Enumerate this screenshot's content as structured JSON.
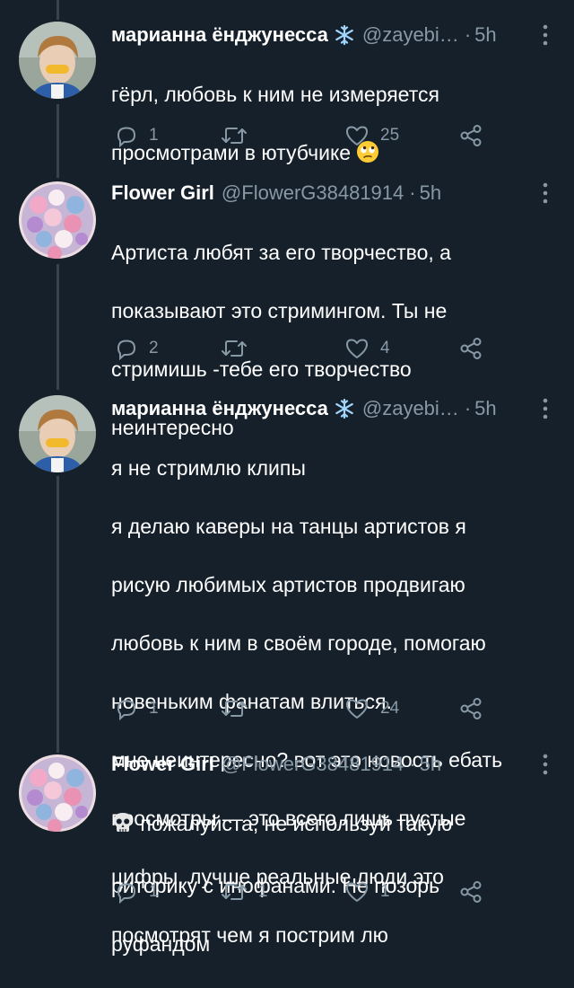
{
  "colors": {
    "background": "#15202b",
    "text": "#ffffff",
    "secondary_text": "#8899a6",
    "thread_line": "#38444d"
  },
  "tweets": [
    {
      "name": "марианна ёнджунесса",
      "name_emoji": "snowflake-icon",
      "handle": "@zayebi…",
      "dot": "·",
      "time": "5h",
      "lines": [
        "гёрл, любовь к ним не измеряется",
        "просмотрами в ютубчике"
      ],
      "trailing_emoji": "eye-roll-emoji",
      "actions": {
        "replies": "1",
        "retweets": "",
        "likes": "25"
      }
    },
    {
      "name": "Flower Girl",
      "handle": "@FlowerG38481914",
      "dot": "·",
      "time": "5h",
      "lines": [
        "Артиста любят за его творчество, а",
        "показывают это стримингом. Ты не",
        "стримишь -тебе его творчество",
        "неинтересно"
      ],
      "actions": {
        "replies": "2",
        "retweets": "",
        "likes": "4"
      }
    },
    {
      "name": "марианна ёнджунесса",
      "name_emoji": "snowflake-icon",
      "handle": "@zayebi…",
      "dot": "·",
      "time": "5h",
      "lines": [
        "я не стримлю клипы",
        "я делаю каверы на танцы артистов я",
        "рисую любимых артистов продвигаю",
        "любовь к ним в своём городе, помогаю",
        "новеньким фанатам влиться.",
        "мне неинтересно? вот это новость ебать",
        "просмотры — это всего лишь пустые",
        "цифры, лучше реальные люди это",
        "посмотрят чем я пострим лю"
      ],
      "actions": {
        "replies": "1",
        "retweets": "",
        "likes": "24"
      }
    },
    {
      "name": "Flower Girl",
      "handle": "@FlowerG38481914",
      "dot": "·",
      "time": "5h",
      "leading_emoji": "skull-emoji",
      "lines": [
        "пожалуйста, не используй такую",
        "риторику с инофанами. Не позорь",
        "руфандом"
      ],
      "actions": {
        "replies": "1",
        "retweets": "1",
        "likes": "1"
      }
    }
  ]
}
